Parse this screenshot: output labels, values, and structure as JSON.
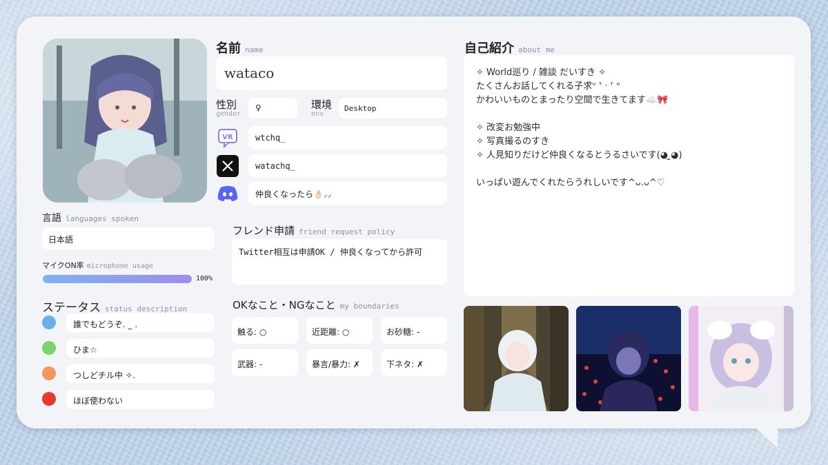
{
  "profile": {
    "name_label": "名前",
    "name_sub": "name",
    "name_value": "wataco",
    "gender_label": "性別",
    "gender_sub": "gender",
    "gender_value": "♀",
    "env_label": "環境",
    "env_sub": "env",
    "env_value": "Desktop",
    "vrchat_id": "wtchq_",
    "x_id": "watachq_",
    "discord_text": "仲良くなったら👌🏻⸝⸝"
  },
  "languages": {
    "label": "言語",
    "sub": "languages spoken",
    "value": "日本語"
  },
  "mic": {
    "label": "マイクON率",
    "sub": "microphone usage",
    "percent_text": "100%",
    "fraction": 1.0
  },
  "status": {
    "label": "ステータス",
    "sub": "status description",
    "items": [
      {
        "color": "#6aaeea",
        "text": "誰でもどうぞ. _ ."
      },
      {
        "color": "#7cd36a",
        "text": "ひま☆"
      },
      {
        "color": "#f2965a",
        "text": "つしどチル中 ✧."
      },
      {
        "color": "#e8392e",
        "text": "ほぼ使わない"
      }
    ]
  },
  "friend": {
    "label": "フレンド申請",
    "sub": "friend request policy",
    "text": "Twitter相互は申請OK / 仲良くなってから許可"
  },
  "boundaries": {
    "label": "OKなこと・NGなこと",
    "sub": "my boundaries",
    "items": [
      "触る: ○",
      "近距離: ○",
      "お砂糖: -",
      "武器: -",
      "暴言/暴力: ✗",
      "下ネタ: ✗"
    ]
  },
  "about": {
    "label": "自己紹介",
    "sub": "about me",
    "lines": [
      "✧ World巡り / 雑談 だいすき ✧",
      "たくさんお話してくれる子求ᐡ ᐪ ᐧ ᐪ ᐡ",
      "かわいいものとまったり空間で生きてます☁️🎀",
      "",
      "✧ 改変お勉強中",
      "✧ 写真撮るのすき",
      "✧ 人見知りだけど仲良くなるとうるさいです(◕ ̫◕)",
      "",
      "いっぱい遊んでくれたらうれしいです^ᴗ.ᴗ^♡"
    ]
  },
  "icons": {
    "vrchat": "vrchat-icon",
    "x": "x-logo-icon",
    "discord": "discord-icon"
  }
}
